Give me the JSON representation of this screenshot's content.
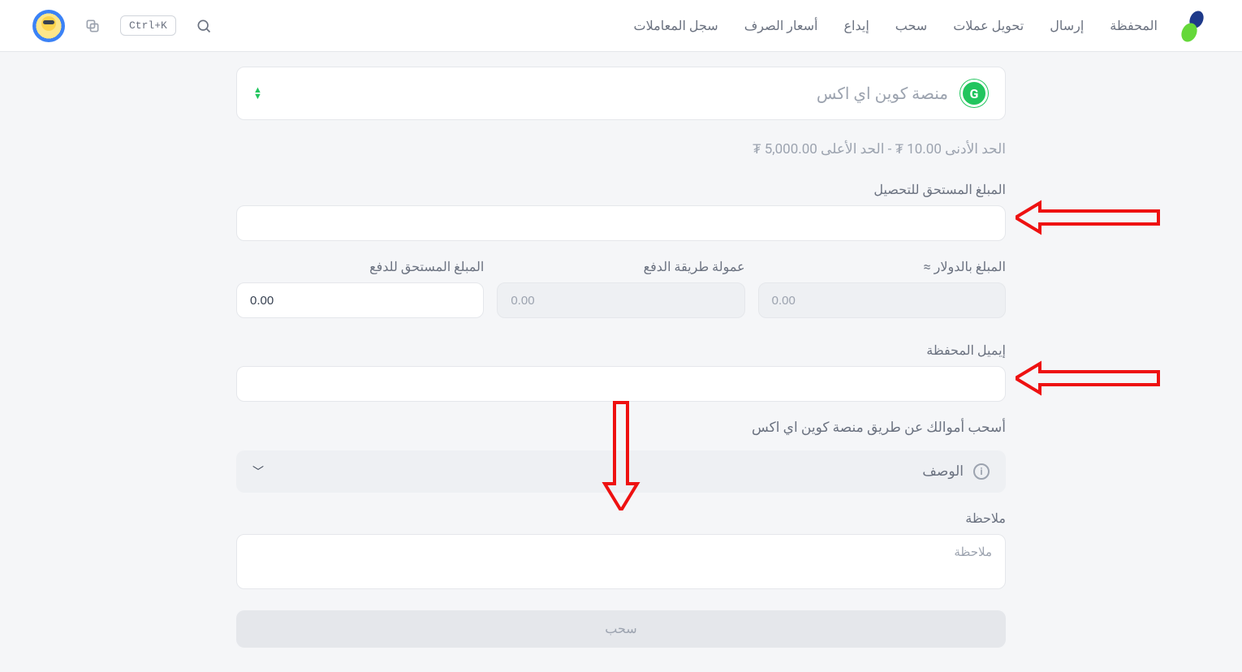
{
  "header": {
    "nav": {
      "wallet": "المحفظة",
      "send": "إرسال",
      "convert": "تحويل عملات",
      "withdraw": "سحب",
      "deposit": "إيداع",
      "rates": "أسعار الصرف",
      "transactions": "سجل المعاملات"
    },
    "shortcut": "Ctrl+K"
  },
  "form": {
    "platform": "منصة كوين اي اكس",
    "limits": "الحد الأدنى 10.00 ₮   -  الحد الأعلى 5,000.00 ₮",
    "amount_label": "المبلغ المستحق للتحصيل",
    "usd_label": "المبلغ بالدولار ≈",
    "usd_value": "0.00",
    "fee_label": "عمولة طريقة الدفع",
    "fee_value": "0.00",
    "pay_label": "المبلغ المستحق للدفع",
    "pay_value": "0.00",
    "email_label": "إيميل المحفظة",
    "info": "أسحب أموالك عن طريق منصة كوين اي اكس",
    "desc_label": "الوصف",
    "note_label": "ملاحظة",
    "note_placeholder": "ملاحظة",
    "submit": "سحب"
  }
}
